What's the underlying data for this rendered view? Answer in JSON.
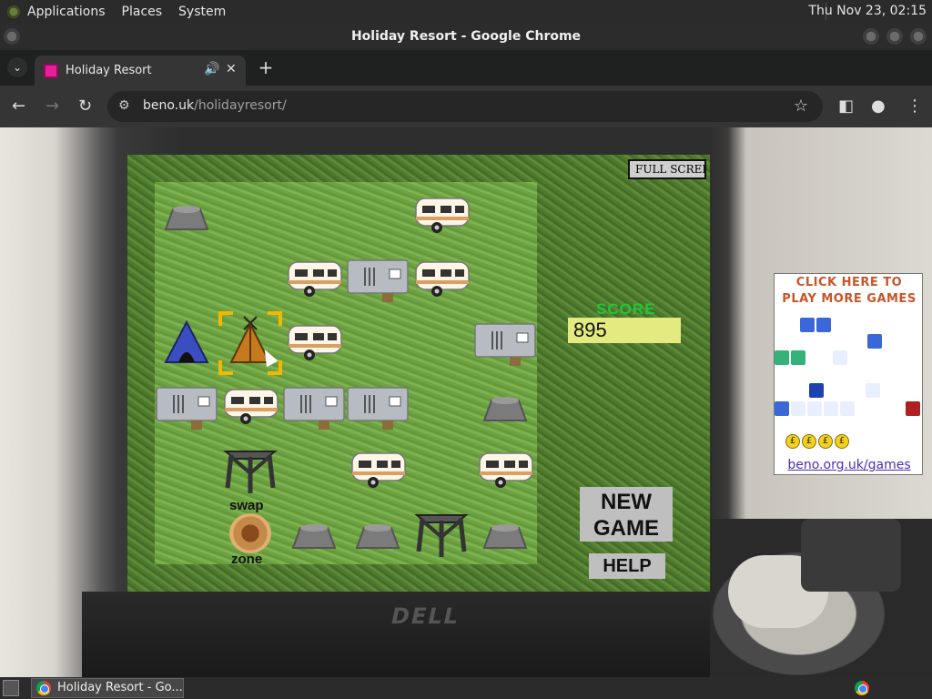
{
  "system_bar": {
    "menus": [
      "Applications",
      "Places",
      "System"
    ],
    "clock": "Thu Nov 23, 02:15"
  },
  "window": {
    "title": "Holiday Resort - Google Chrome"
  },
  "tab": {
    "title": "Holiday Resort"
  },
  "address": {
    "host": "beno.uk",
    "path": "/holidayresort/"
  },
  "game": {
    "full_screen_label": "FULL SCREEN",
    "score_label": "SCORE",
    "score_value": "895",
    "new_game_line1": "NEW",
    "new_game_line2": "GAME",
    "help_label": "HELP",
    "swap_label": "swap",
    "zone_label": "zone",
    "grid": [
      [
        "rock",
        "empty",
        "empty",
        "empty",
        "caravan",
        "empty"
      ],
      [
        "empty",
        "empty",
        "caravan",
        "mobile-home",
        "caravan",
        "empty"
      ],
      [
        "tent-blue",
        "tent-orange",
        "caravan",
        "empty",
        "empty",
        "mobile-home"
      ],
      [
        "mobile-home",
        "caravan",
        "mobile-home",
        "mobile-home",
        "empty",
        "rock"
      ],
      [
        "empty",
        "empty",
        "empty",
        "caravan",
        "empty",
        "caravan"
      ],
      [
        "empty",
        "empty",
        "rock",
        "rock",
        "tower",
        "rock"
      ]
    ],
    "held_item": "tower",
    "selected_cell": "tent-orange"
  },
  "ad": {
    "line1": "CLICK HERE TO",
    "line2": "PLAY MORE GAMES",
    "url": "beno.org.uk/games",
    "coin_symbol": "£"
  },
  "taskbar": {
    "item": "Holiday Resort - Go..."
  }
}
